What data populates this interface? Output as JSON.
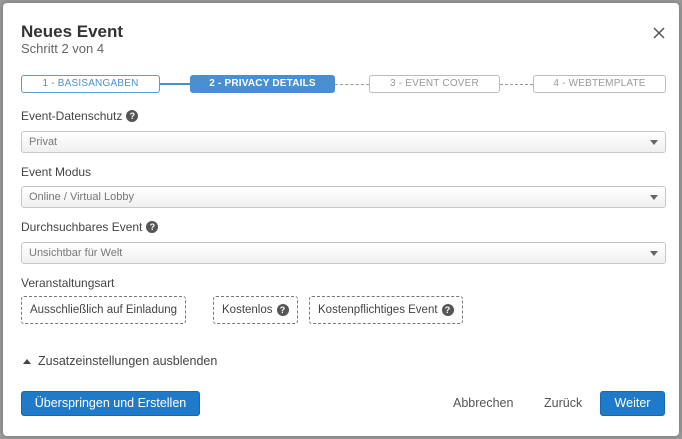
{
  "dialog": {
    "title": "Neues Event",
    "subtitle": "Schritt 2 von 4",
    "close_icon": "close-icon"
  },
  "stepper": {
    "steps": [
      {
        "label": "1 - BASISANGABEN",
        "state": "done"
      },
      {
        "label": "2 - PRIVACY DETAILS",
        "state": "active"
      },
      {
        "label": "3 - EVENT COVER",
        "state": "upcoming"
      },
      {
        "label": "4 - WEBTEMPLATE",
        "state": "upcoming"
      }
    ],
    "accent_color": "#4a8fd0"
  },
  "fields": {
    "privacy": {
      "label": "Event-Datenschutz",
      "value": "Privat",
      "has_help": true
    },
    "mode": {
      "label": "Event Modus",
      "value": "Online / Virtual Lobby",
      "has_help": false
    },
    "searchable": {
      "label": "Durchsuchbares Event",
      "value": "Unsichtbar für Welt",
      "has_help": true
    }
  },
  "event_type": {
    "label": "Veranstaltungsart",
    "options": [
      {
        "label": "Ausschließlich auf Einladung"
      },
      {
        "label": "Kostenlos"
      },
      {
        "label": "Kostenpflichtiges Event"
      }
    ]
  },
  "extra_settings_toggle": "Zusatzeinstellungen ausblenden",
  "footer": {
    "skip_create": "Überspringen und Erstellen",
    "cancel": "Abbrechen",
    "back": "Zurück",
    "next": "Weiter",
    "primary_color": "#1f7ac9"
  }
}
